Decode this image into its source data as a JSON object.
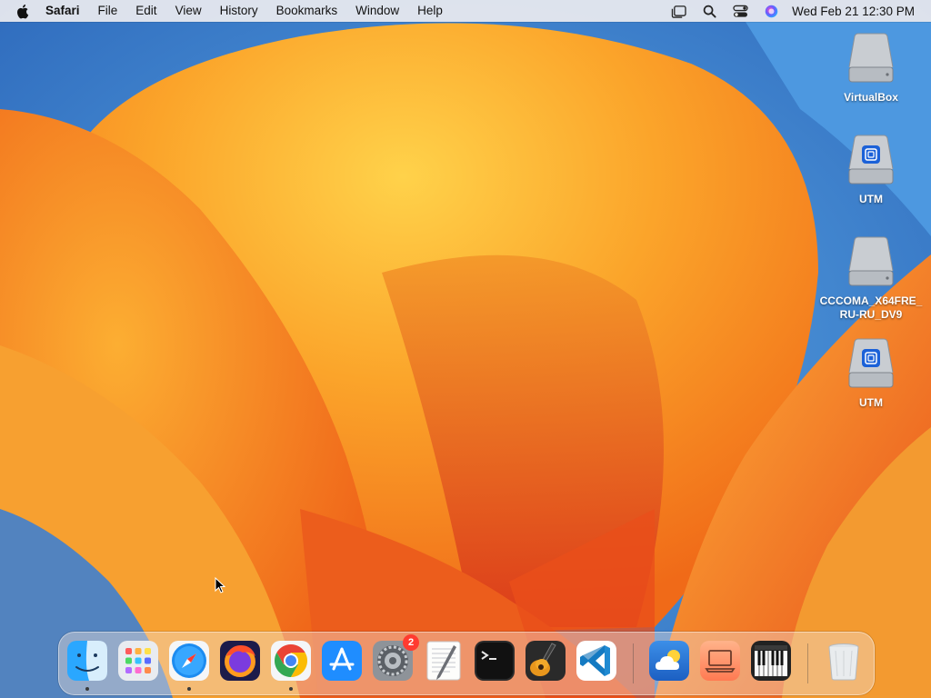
{
  "menubar": {
    "app_name": "Safari",
    "menus": [
      "File",
      "Edit",
      "View",
      "History",
      "Bookmarks",
      "Window",
      "Help"
    ],
    "clock": "Wed Feb 21  12:30 PM",
    "status_icons": [
      "stage-manager-icon",
      "search-icon",
      "control-center-icon",
      "siri-icon"
    ]
  },
  "desktop": {
    "icons": [
      {
        "label": "VirtualBox",
        "icon": "disk-image-icon"
      },
      {
        "label": "UTM",
        "icon": "utm-disk-icon"
      },
      {
        "label": "CCCOMA_X64FRE_RU-RU_DV9",
        "icon": "disk-image-icon"
      },
      {
        "label": "UTM",
        "icon": "utm-disk-icon"
      }
    ]
  },
  "dock": {
    "apps": [
      {
        "name": "Finder",
        "icon": "finder-icon",
        "running": true
      },
      {
        "name": "Launchpad",
        "icon": "launchpad-icon",
        "running": false
      },
      {
        "name": "Safari",
        "icon": "safari-icon",
        "running": true
      },
      {
        "name": "Firefox",
        "icon": "firefox-icon",
        "running": false
      },
      {
        "name": "Google Chrome",
        "icon": "chrome-icon",
        "running": true
      },
      {
        "name": "App Store",
        "icon": "app-store-icon",
        "running": false
      },
      {
        "name": "System Settings",
        "icon": "system-settings-icon",
        "running": false,
        "badge": "2"
      },
      {
        "name": "TextEdit",
        "icon": "textedit-icon",
        "running": false
      },
      {
        "name": "Terminal",
        "icon": "terminal-icon",
        "running": false
      },
      {
        "name": "GarageBand",
        "icon": "garageband-icon",
        "running": false
      },
      {
        "name": "Visual Studio Code",
        "icon": "vscode-icon",
        "running": false
      },
      {
        "name": "Weather",
        "icon": "weather-icon",
        "running": false
      },
      {
        "name": "Screen Sharing",
        "icon": "screen-sharing-icon",
        "running": false
      },
      {
        "name": "Piano",
        "icon": "piano-icon",
        "running": false
      },
      {
        "name": "Trash",
        "icon": "trash-icon",
        "running": false
      }
    ]
  },
  "colors": {
    "wallpaper_orange": "#f59a1e",
    "wallpaper_deep": "#e0461a",
    "wallpaper_blue": "#3a7fd0",
    "badge": "#ff3b30"
  }
}
